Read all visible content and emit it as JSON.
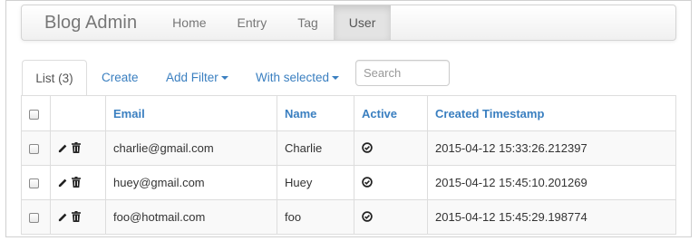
{
  "navbar": {
    "brand": "Blog Admin",
    "items": [
      {
        "label": "Home"
      },
      {
        "label": "Entry"
      },
      {
        "label": "Tag"
      },
      {
        "label": "User",
        "active": true
      }
    ]
  },
  "tabs": {
    "list": "List (3)",
    "create": "Create",
    "add_filter": "Add Filter",
    "with_selected": "With selected"
  },
  "search": {
    "placeholder": "Search",
    "value": ""
  },
  "table": {
    "columns": {
      "email": "Email",
      "name": "Name",
      "active": "Active",
      "created": "Created Timestamp"
    },
    "rows": [
      {
        "email": "charlie@gmail.com",
        "name": "Charlie",
        "active": true,
        "created": "2015-04-12 15:33:26.212397"
      },
      {
        "email": "huey@gmail.com",
        "name": "Huey",
        "active": true,
        "created": "2015-04-12 15:45:10.201269"
      },
      {
        "email": "foo@hotmail.com",
        "name": "foo",
        "active": true,
        "created": "2015-04-12 15:45:29.198774"
      }
    ]
  },
  "colors": {
    "link": "#3a7fc0",
    "muted": "#777777",
    "border": "#dddddd",
    "stripe": "#f9f9f9"
  },
  "icons": {
    "edit": "pencil-icon",
    "delete": "trash-icon",
    "active": "check-circle-icon"
  }
}
